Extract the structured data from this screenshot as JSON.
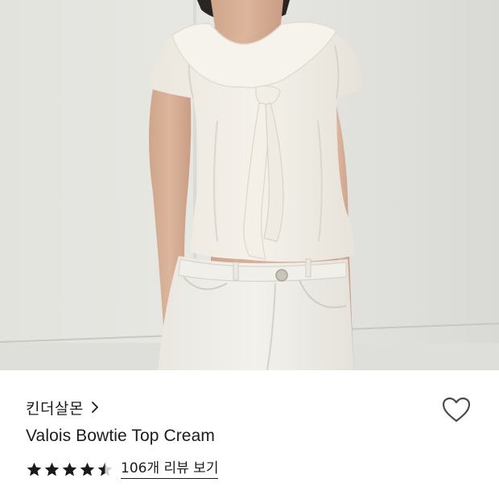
{
  "product": {
    "brand": "킨더살몬",
    "name": "Valois Bowtie Top Cream",
    "rating": 4.5,
    "rating_max": 5,
    "review_link_label": "106개 리뷰 보기"
  },
  "icons": {
    "brand_chevron": "chevron-right-icon",
    "wishlist": "heart-outline-icon",
    "rating_star": "star-icon"
  },
  "colors": {
    "text": "#1c1c1c",
    "star_filled": "#1a1a1a",
    "star_empty": "#cfcfcf",
    "heart_outline": "#4a4a4a"
  }
}
